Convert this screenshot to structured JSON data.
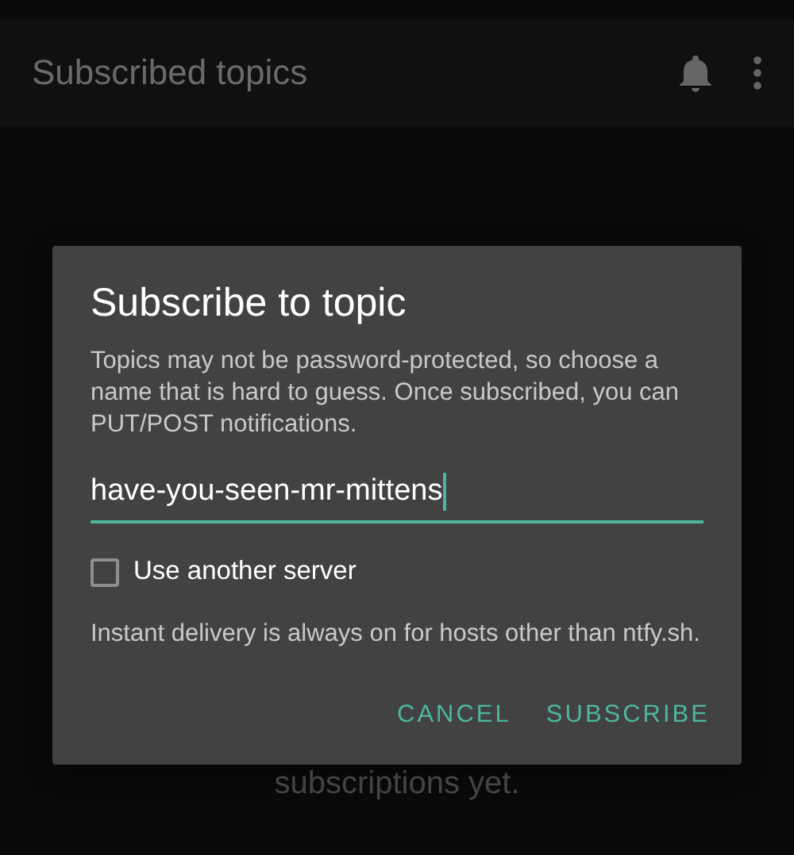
{
  "app_bar": {
    "title": "Subscribed topics"
  },
  "background_text": "subscriptions yet.",
  "dialog": {
    "title": "Subscribe to topic",
    "description": "Topics may not be password-protected, so choose a name that is hard to guess. Once subscribed, you can PUT/POST notifications.",
    "topic_field": {
      "value": "have-you-seen-mr-mittens",
      "focused": true
    },
    "use_another_server": {
      "label": "Use another server",
      "checked": false
    },
    "note": "Instant delivery is always on for hosts other than ntfy.sh.",
    "buttons": [
      "CANCEL",
      "SUBSCRIBE"
    ]
  }
}
